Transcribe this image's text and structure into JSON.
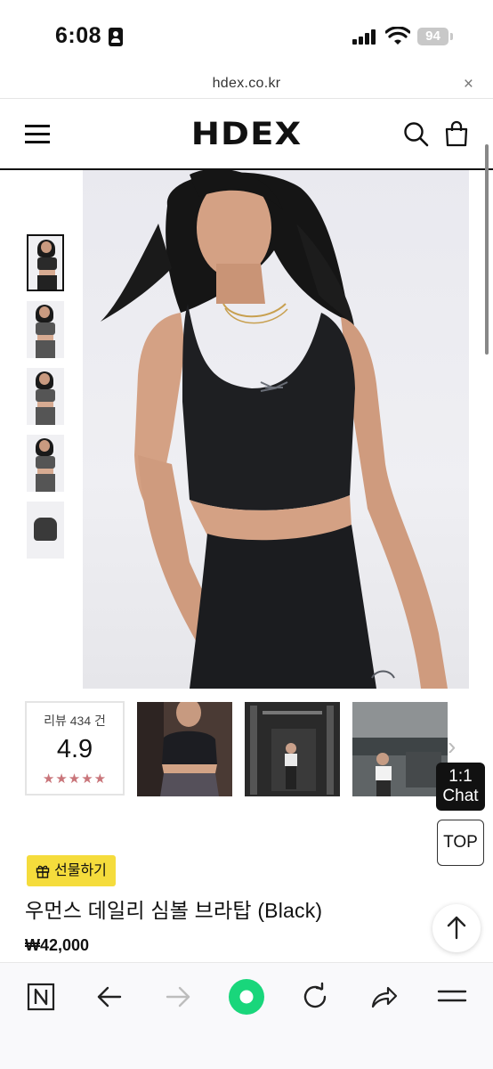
{
  "status_bar": {
    "time": "6:08",
    "battery_level": "94"
  },
  "browser": {
    "url": "hdex.co.kr",
    "close_label": "×"
  },
  "site_header": {
    "logo": "HDEX"
  },
  "gallery": {
    "thumbnail_count": 5,
    "selected_index": 0
  },
  "review": {
    "count_label": "리뷰 434 건",
    "score": "4.9",
    "stars": "★★★★★"
  },
  "floating": {
    "chat_label_line1": "1:1",
    "chat_label_line2": "Chat",
    "top_label": "TOP"
  },
  "product": {
    "gift_label": "선물하기",
    "title": "우먼스 데일리 심볼 브라탑 (Black)",
    "price": "₩42,000"
  },
  "icons": {
    "next_arrow": "›",
    "accent_green": "#19d67b",
    "gift_badge_color": "#f5dc3c",
    "star_color": "#c9757a"
  }
}
